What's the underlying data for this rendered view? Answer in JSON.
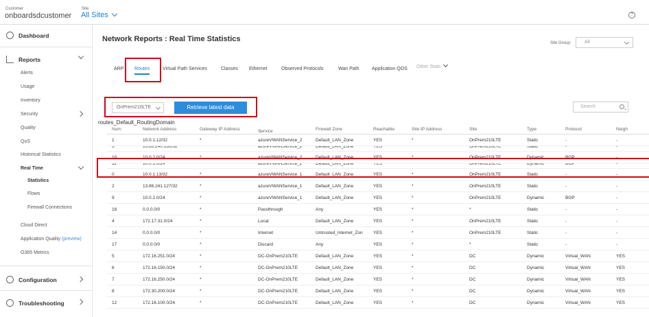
{
  "header": {
    "customer_label": "Customer",
    "customer_name": "onboardsdcustomer",
    "site_label": "Site",
    "site_name": "All Sites",
    "help": "?"
  },
  "sidebar": {
    "dashboard": "Dashboard",
    "reports": "Reports",
    "report_items": [
      "Alerts",
      "Usage",
      "Inventory",
      "Security",
      "Quality",
      "QoS",
      "Historical Statistics"
    ],
    "real_time": "Real Time",
    "real_time_items": [
      "Statistics",
      "Flows",
      "Firewall Connections"
    ],
    "cloud_direct": "Cloud Direct",
    "app_quality": "Application Quality",
    "app_quality_preview": "(preview)",
    "o365": "O365 Metrics",
    "configuration": "Configuration",
    "troubleshooting": "Troubleshooting"
  },
  "main": {
    "title": "Network Reports : Real Time Statistics",
    "site_group_label": "Site Group:",
    "site_group_value": "All",
    "tabs": [
      "ARP",
      "Routes",
      "Virtual Path Services",
      "Classes",
      "Ethernet",
      "Observed Protocols",
      "Wan Path",
      "Application QOS",
      "Other Stats"
    ],
    "device": "OnPrem210LTE",
    "retrieve_label": "Retrieve latest data",
    "search_placeholder": "Search",
    "table_title": "routes_Default_RoutingDomain",
    "columns": [
      "Num",
      "Network Address",
      "Gateway IP Address",
      "Service",
      "Firewall Zone",
      "Reachable",
      "Site IP Address",
      "Site",
      "Type",
      "Protocol",
      "Neigh"
    ],
    "rows": [
      [
        "1",
        "10.0.1.12/32",
        "*",
        "azureVWANService_2",
        "Default_LAN_Zone",
        "YES",
        "*",
        "OnPrem210LTE",
        "Static",
        "-",
        "-"
      ],
      [
        "3",
        "13.86.240.166/32",
        "*",
        "azureVWANService_2",
        "Default_LAN_Zone",
        "YES",
        "*",
        "OnPrem210LTE",
        "Static",
        "-",
        "-"
      ],
      [
        "10",
        "10.0.2.0/24",
        "*",
        "azureVWANService_2",
        "Default_LAN_Zone",
        "YES",
        "*",
        "OnPrem210LTE",
        "Dynamic",
        "BGP",
        "-"
      ],
      [
        "11",
        "10.0.1.0/24",
        "*",
        "azureVWANService_2",
        "Default_LAN_Zone",
        "YES",
        "*",
        "OnPrem210LTE",
        "Dynamic",
        "BGP",
        "-"
      ],
      [
        "0",
        "10.0.1.13/32",
        "*",
        "azureVWANService_1",
        "Default_LAN_Zone",
        "YES",
        "*",
        "OnPrem210LTE",
        "Static",
        "-",
        "-"
      ],
      [
        "2",
        "13.86.241.127/32",
        "*",
        "azureVWANService_1",
        "Default_LAN_Zone",
        "YES",
        "*",
        "OnPrem210LTE",
        "Static",
        "-",
        "-"
      ],
      [
        "9",
        "10.0.2.0/24",
        "*",
        "azureVWANService_1",
        "Default_LAN_Zone",
        "YES",
        "*",
        "OnPrem210LTE",
        "Dynamic",
        "BGP",
        "-"
      ],
      [
        "16",
        "0.0.0.0/0",
        "*",
        "Passthrough",
        "Any",
        "YES",
        "*",
        "*",
        "Static",
        "-",
        "-"
      ],
      [
        "4",
        "172.17.31.0/24",
        "*",
        "Local",
        "Default_LAN_Zone",
        "YES",
        "*",
        "OnPrem210LTE",
        "Static",
        "-",
        "-"
      ],
      [
        "14",
        "0.0.0.0/0",
        "*",
        "Internet",
        "Untrusted_Internet_Zon",
        "YES",
        "*",
        "OnPrem210LTE",
        "Static",
        "-",
        "-"
      ],
      [
        "17",
        "0.0.0.0/0",
        "*",
        "Discard",
        "Any",
        "YES",
        "*",
        "*",
        "Static",
        "-",
        "-"
      ],
      [
        "5",
        "172.16.251.0/24",
        "*",
        "DC-OnPrem210LTE",
        "Default_LAN_Zone",
        "YES",
        "*",
        "DC",
        "Dynamic",
        "Virtual_WAN",
        "YES"
      ],
      [
        "6",
        "172.16.150.0/24",
        "*",
        "DC-OnPrem210LTE",
        "Default_LAN_Zone",
        "YES",
        "*",
        "DC",
        "Dynamic",
        "Virtual_WAN",
        "YES"
      ],
      [
        "7",
        "172.16.250.0/24",
        "*",
        "DC-OnPrem210LTE",
        "Default_LAN_Zone",
        "YES",
        "*",
        "DC",
        "Dynamic",
        "Virtual_WAN",
        "YES"
      ],
      [
        "8",
        "172.30.200.0/24",
        "*",
        "DC-OnPrem210LTE",
        "Default_LAN_Zone",
        "YES",
        "*",
        "DC",
        "Dynamic",
        "Virtual_WAN",
        "YES"
      ],
      [
        "12",
        "172.16.100.0/24",
        "*",
        "DC-OnPrem210LTE",
        "Default_LAN_Zone",
        "YES",
        "*",
        "DC",
        "Dynamic",
        "Virtual_WAN",
        "YES"
      ]
    ]
  },
  "colors": {
    "accent": "#1f7fcf",
    "button": "#2d8ddb",
    "highlight": "#d0021b"
  },
  "icons": {
    "dashboard": "dashboard-icon",
    "reports": "reports-icon",
    "configuration": "gear-icon",
    "troubleshooting": "wrench-icon",
    "search": "search-icon"
  }
}
